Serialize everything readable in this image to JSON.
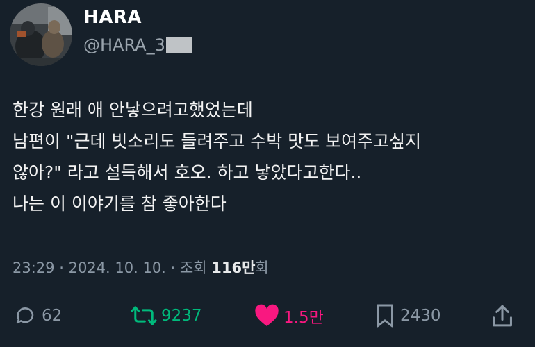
{
  "user": {
    "display_name": "HARA",
    "handle": "@HARA_3"
  },
  "tweet": {
    "lines": [
      "한강 원래 애 안낳으려고했었는데",
      "남편이 \"근데 빗소리도 들려주고 수박 맛도 보여주고싶지",
      "않아?\" 라고 설득해서 호오. 하고 낳았다고한다..",
      "나는 이 이야기를 참 좋아한다"
    ]
  },
  "meta": {
    "time": "23:29",
    "date": "2024. 10. 10.",
    "views_label": "조회",
    "views_count": "116만",
    "views_suffix": "회",
    "separator": "·"
  },
  "actions": {
    "reply_count": "62",
    "retweet_count": "9237",
    "like_count": "1.5만",
    "bookmark_count": "2430"
  },
  "icons": {
    "reply": "speech-bubble-icon",
    "retweet": "retweet-icon",
    "like": "heart-icon",
    "bookmark": "bookmark-icon",
    "share": "share-icon"
  },
  "colors": {
    "background": "#16202a",
    "retweet": "#00ba7c",
    "like": "#f91880",
    "muted": "#8b98a5"
  }
}
